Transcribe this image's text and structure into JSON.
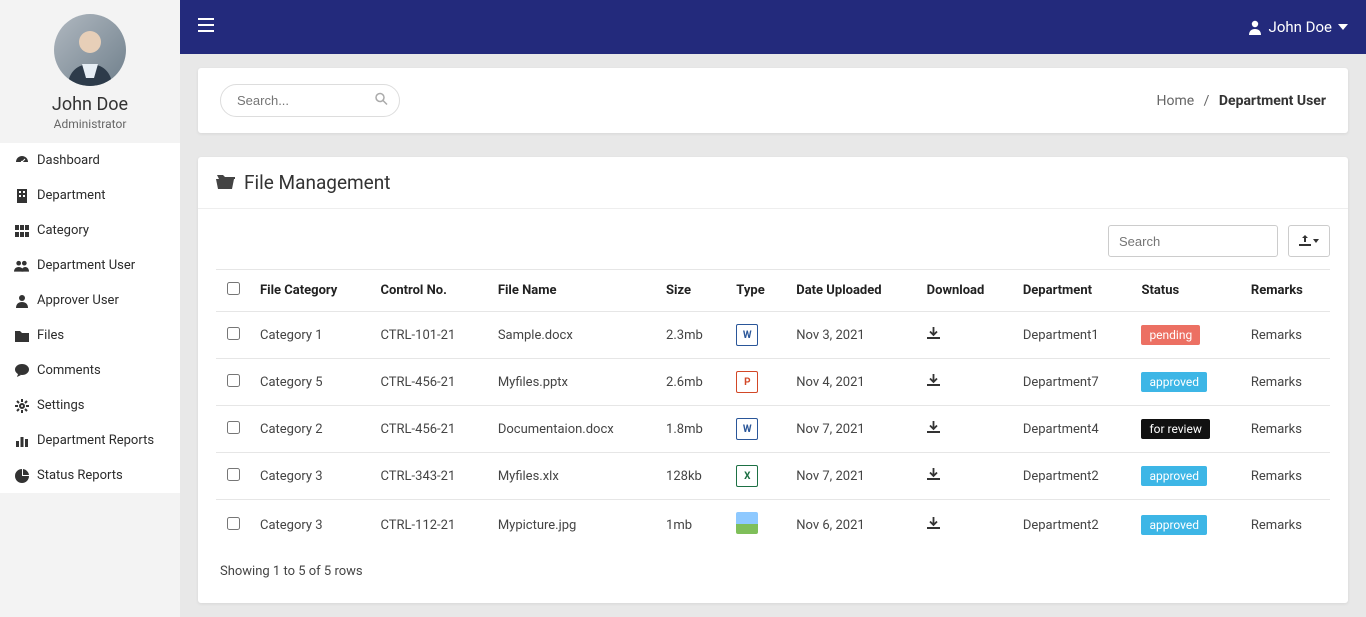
{
  "profile": {
    "name": "John Doe",
    "role": "Administrator"
  },
  "topbar": {
    "user": "John Doe"
  },
  "search": {
    "placeholder": "Search..."
  },
  "breadcrumb": {
    "home": "Home",
    "current": "Department User"
  },
  "panel": {
    "title": "File Management"
  },
  "toolbar": {
    "search_placeholder": "Search"
  },
  "nav": [
    {
      "icon": "tachometer",
      "label": "Dashboard"
    },
    {
      "icon": "building",
      "label": "Department"
    },
    {
      "icon": "th",
      "label": "Category"
    },
    {
      "icon": "users",
      "label": "Department User"
    },
    {
      "icon": "user",
      "label": "Approver User"
    },
    {
      "icon": "folder",
      "label": "Files"
    },
    {
      "icon": "comment",
      "label": "Comments"
    },
    {
      "icon": "cog",
      "label": "Settings"
    },
    {
      "icon": "chart-bar",
      "label": "Department Reports"
    },
    {
      "icon": "chart-pie",
      "label": "Status Reports"
    }
  ],
  "columns": [
    "",
    "File Category",
    "Control No.",
    "File Name",
    "Size",
    "Type",
    "Date Uploaded",
    "Download",
    "Department",
    "Status",
    "Remarks"
  ],
  "rows": [
    {
      "cat": "Category 1",
      "ctrl": "CTRL-101-21",
      "file": "Sample.docx",
      "size": "2.3mb",
      "type": "word",
      "date": "Nov 3, 2021",
      "dept": "Department1",
      "status": "pending",
      "remarks": "Remarks"
    },
    {
      "cat": "Category 5",
      "ctrl": "CTRL-456-21",
      "file": "Myfiles.pptx",
      "size": "2.6mb",
      "type": "ppt",
      "date": "Nov 4, 2021",
      "dept": "Department7",
      "status": "approved",
      "remarks": "Remarks"
    },
    {
      "cat": "Category 2",
      "ctrl": "CTRL-456-21",
      "file": "Documentaion.docx",
      "size": "1.8mb",
      "type": "word",
      "date": "Nov 7, 2021",
      "dept": "Department4",
      "status": "for review",
      "remarks": "Remarks"
    },
    {
      "cat": "Category 3",
      "ctrl": "CTRL-343-21",
      "file": "Myfiles.xlx",
      "size": "128kb",
      "type": "xls",
      "date": "Nov 7, 2021",
      "dept": "Department2",
      "status": "approved",
      "remarks": "Remarks"
    },
    {
      "cat": "Category 3",
      "ctrl": "CTRL-112-21",
      "file": "Mypicture.jpg",
      "size": "1mb",
      "type": "img",
      "date": "Nov 6, 2021",
      "dept": "Department2",
      "status": "approved",
      "remarks": "Remarks"
    }
  ],
  "footer": "Showing 1 to 5 of 5 rows"
}
